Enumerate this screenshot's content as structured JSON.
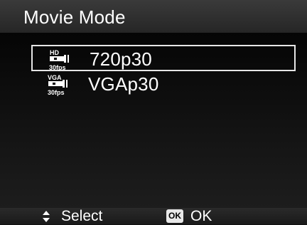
{
  "header": {
    "title": "Movie Mode"
  },
  "menu": {
    "items": [
      {
        "label": "720p30",
        "icon": "hd-30fps-icon",
        "icon_top": "HD",
        "icon_bottom": "30fps",
        "selected": true
      },
      {
        "label": "VGAp30",
        "icon": "vga-30fps-icon",
        "icon_top": "VGA",
        "icon_bottom": "30fps",
        "selected": false
      }
    ]
  },
  "footer": {
    "select_label": "Select",
    "ok_badge": "OK",
    "ok_label": "OK"
  }
}
